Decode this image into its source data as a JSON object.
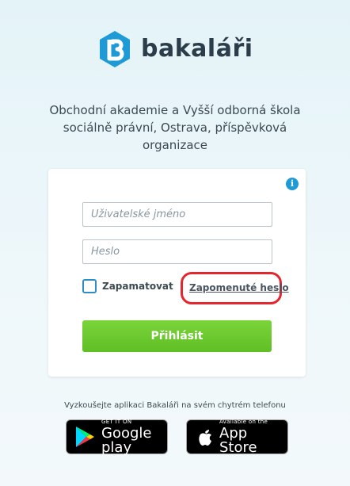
{
  "brand": {
    "name": "bakaláři",
    "color": "#1e9ad6"
  },
  "school_name": "Obchodní akademie a Vyšší odborná škola sociálně právní, Ostrava, příspěvková organizace",
  "login": {
    "username_placeholder": "Uživatelské jméno",
    "password_placeholder": "Heslo",
    "remember_label": "Zapamatovat",
    "forgot_password": "Zapomenuté heslo",
    "submit_label": "Přihlásit",
    "info_icon_glyph": "i"
  },
  "promo": {
    "text": "Vyzkoušejte aplikaci Bakaláři na svém chytrém telefonu",
    "google_play": {
      "small": "GET IT ON",
      "big": "Google play"
    },
    "app_store": {
      "small": "Available on the",
      "big": "App Store"
    }
  },
  "colors": {
    "button_green": "#66c22b",
    "highlight_red": "#e3262f"
  }
}
